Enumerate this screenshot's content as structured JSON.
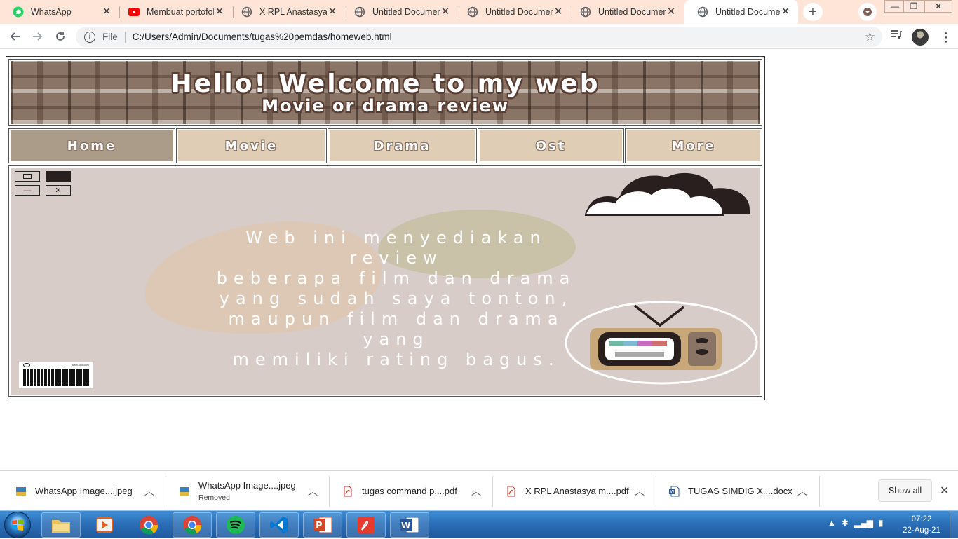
{
  "browser": {
    "tabs": [
      {
        "title": "WhatsApp",
        "icon": "whatsapp-icon",
        "active": false
      },
      {
        "title": "Membuat portofol",
        "icon": "youtube-icon",
        "active": false
      },
      {
        "title": "X RPL Anastasya n",
        "icon": "globe-icon",
        "active": false
      },
      {
        "title": "Untitled Documen",
        "icon": "globe-icon",
        "active": false
      },
      {
        "title": "Untitled Documen",
        "icon": "globe-icon",
        "active": false
      },
      {
        "title": "Untitled Documen",
        "icon": "globe-icon",
        "active": false
      },
      {
        "title": "Untitled Documen",
        "icon": "globe-icon",
        "active": true
      }
    ],
    "address": {
      "scheme_label": "File",
      "url": "C:/Users/Admin/Documents/tugas%20pemdas/homeweb.html"
    }
  },
  "page": {
    "banner": {
      "title": "Hello!  Welcome to my web",
      "subtitle": "Movie or drama review"
    },
    "nav": [
      {
        "label": "Home",
        "active": true
      },
      {
        "label": "Movie",
        "active": false
      },
      {
        "label": "Drama",
        "active": false
      },
      {
        "label": "Ost",
        "active": false
      },
      {
        "label": "More",
        "active": false
      }
    ],
    "hero": {
      "lines": [
        "Web ini menyediakan review",
        "beberapa film dan drama",
        "yang sudah saya tonton,",
        "maupun film dan drama yang",
        "memiliki rating bagus."
      ],
      "barcode_tag": "www.###.com"
    },
    "colors": {
      "nav_bg": "#e0cdb5",
      "nav_active_bg": "#ab9c89",
      "hero_bg": "#d8ccc8"
    }
  },
  "downloads": {
    "items": [
      {
        "name": "WhatsApp Image....jpeg",
        "status": "",
        "icon": "image-file-icon"
      },
      {
        "name": "WhatsApp Image....jpeg",
        "status": "Removed",
        "icon": "image-file-icon"
      },
      {
        "name": "tugas command p....pdf",
        "status": "",
        "icon": "pdf-file-icon"
      },
      {
        "name": "X RPL Anastasya m....pdf",
        "status": "",
        "icon": "pdf-file-icon"
      },
      {
        "name": "TUGAS SIMDIG X....docx",
        "status": "",
        "icon": "word-file-icon"
      }
    ],
    "show_all_label": "Show all"
  },
  "taskbar": {
    "time": "07:22",
    "date": "22-Aug-21"
  }
}
